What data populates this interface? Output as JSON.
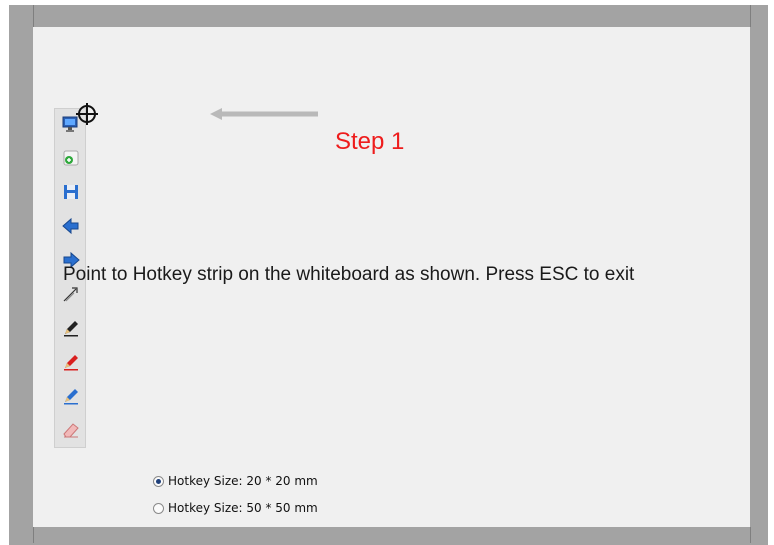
{
  "calibration": {
    "step_title": "Step 1",
    "instruction": "Point to Hotkey strip on the whiteboard as shown. Press ESC to exit"
  },
  "hotkey_strip": {
    "icons": [
      "monitor-icon",
      "new-page-icon",
      "save-icon",
      "previous-page-icon",
      "next-page-icon",
      "pointer-icon",
      "black-pen-icon",
      "red-pen-icon",
      "blue-pen-icon",
      "eraser-icon"
    ]
  },
  "hotkey_size_options": [
    {
      "label": "Hotkey Size: 20 * 20 mm",
      "selected": true
    },
    {
      "label": "Hotkey Size: 50 * 50 mm",
      "selected": false
    }
  ],
  "colors": {
    "step_title": "#ee1c1c",
    "canvas_background": "#f0f0f0",
    "frame": "#a3a3a3",
    "arrow": "#b9b9b9"
  }
}
